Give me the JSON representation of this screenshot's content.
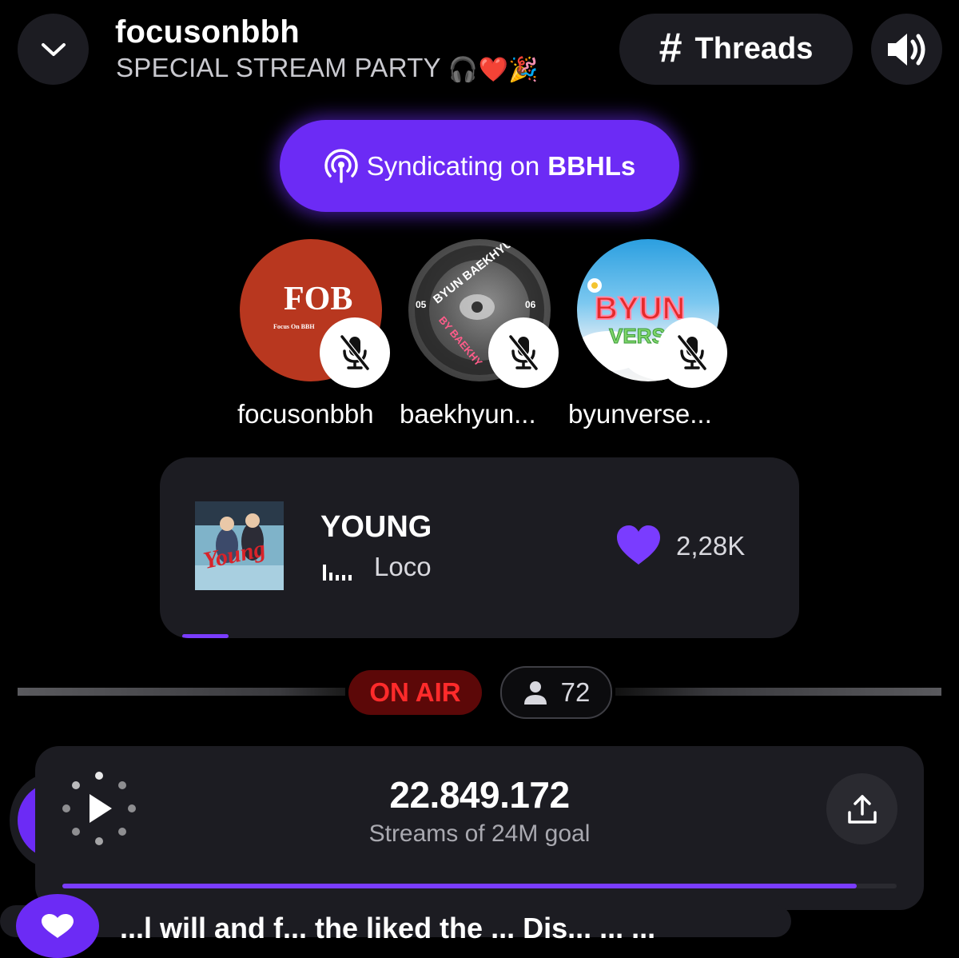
{
  "header": {
    "room_name": "focusonbbh",
    "room_subtitle": "SPECIAL STREAM PARTY",
    "subtitle_emojis": "🎧❤️🎉",
    "threads_label": "Threads",
    "threads_symbol": "#"
  },
  "syndicate": {
    "prefix": "Syndicating on",
    "network": "BBHLs"
  },
  "speakers": [
    {
      "name": "focusonbbh",
      "avatar_text": "FOB",
      "avatar_caption": "Focus On BBH",
      "muted": true
    },
    {
      "name": "baekhyun...",
      "avatar_text": "BYUN BAEKHYUN",
      "avatar_caption": "BY BAEKHY",
      "avatar_nums": [
        "05",
        "06"
      ],
      "muted": true
    },
    {
      "name": "byunverse...",
      "avatar_text": "BYUN",
      "avatar_caption": "VERS",
      "muted": true
    }
  ],
  "now_playing": {
    "title": "YOUNG",
    "artist": "Loco",
    "cover_text": "Young",
    "likes": "2,28K",
    "progress": 0.07
  },
  "status": {
    "on_air_label": "ON AIR",
    "listener_count": "72"
  },
  "streams": {
    "count": "22.849.172",
    "goal_label": "Streams of 24M goal",
    "goal_progress": 0.952
  },
  "chat": {
    "partial_text": "...l will and f... the liked the ... Dis... ... ..."
  },
  "colors": {
    "accent": "#6c2bf5",
    "card": "#1c1c22",
    "on_air_bg": "#5c0808",
    "on_air_text": "#ff2b2b"
  }
}
